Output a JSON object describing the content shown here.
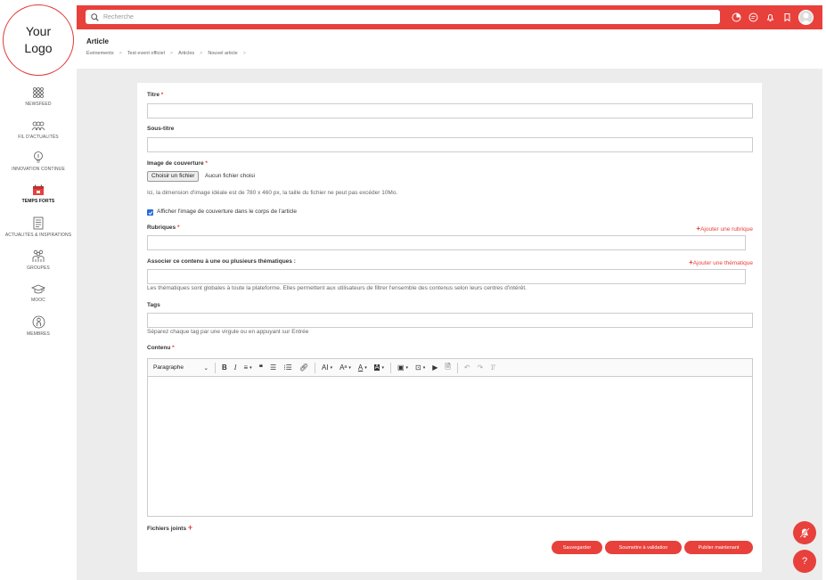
{
  "logo": {
    "line1": "Your",
    "line2": "Logo"
  },
  "sidebar": {
    "items": [
      {
        "label": "NEWSFEED",
        "icon": "grid-dots-icon"
      },
      {
        "label": "FIL D'ACTUALITÉS",
        "icon": "people-group-icon"
      },
      {
        "label": "INNOVATION CONTINUE",
        "icon": "lightbulb-icon"
      },
      {
        "label": "TEMPS FORTS",
        "icon": "calendar-icon",
        "active": true
      },
      {
        "label": "ACTUALITÉS & INSPIRATIONS",
        "icon": "document-icon"
      },
      {
        "label": "GROUPES",
        "icon": "users-icon"
      },
      {
        "label": "MOOC",
        "icon": "graduation-cap-icon"
      },
      {
        "label": "MEMBRES",
        "icon": "member-icon"
      }
    ]
  },
  "topbar": {
    "search_placeholder": "Recherche",
    "color": "#e8403b"
  },
  "header": {
    "title": "Article",
    "breadcrumb": [
      "Événements",
      "Test event officiel",
      "Articles",
      "Nouvel article"
    ]
  },
  "form": {
    "title_label": "Titre",
    "subtitle_label": "Sous-titre",
    "cover_label": "Image de couverture",
    "file_button": "Choisir un fichier",
    "file_none": "Aucun fichier choisi",
    "cover_help": "Ici, la dimension d'image idéale est de 780 x 460 px, la taille du fichier ne peut pas excéder 10Mo.",
    "cover_checkbox": "Afficher l'image de couverture dans le corps de l'article",
    "rubriques_label": "Rubriques",
    "add_rubrique": "Ajouter une rubrique",
    "themes_label": "Associer ce contenu à une ou plusieurs thématiques :",
    "add_theme": "Ajouter une thématique",
    "themes_help": "Les thématiques sont globales à toute la plateforme. Elles permettent aux utilisateurs de filtrer l'ensemble des contenus selon leurs centres d'intérêt.",
    "tags_label": "Tags",
    "tags_help": "Séparez chaque tag par une virgule ou en appuyant sur Entrée",
    "content_label": "Contenu",
    "paragraph_select": "Paragraphe",
    "attachments_label": "Fichiers joints"
  },
  "actions": {
    "save": "Sauvegarder",
    "submit": "Soumettre à validation",
    "publish": "Publier maintenant"
  },
  "fab": {
    "help": "?"
  }
}
